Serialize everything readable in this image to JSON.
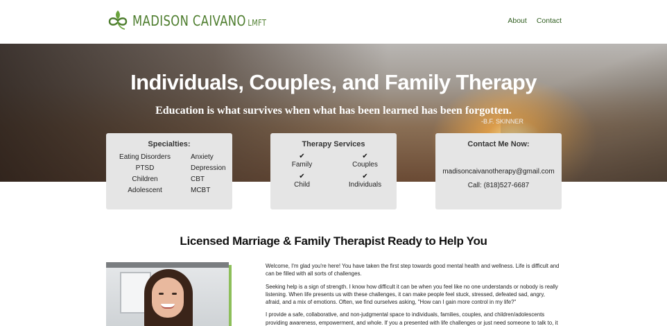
{
  "header": {
    "logo_text": "MADISON CAIVANO",
    "logo_suffix": "LMFT",
    "nav": [
      {
        "label": "About"
      },
      {
        "label": "Contact"
      }
    ]
  },
  "hero": {
    "title": "Individuals, Couples, and Family Therapy",
    "quote": "Education is what survives when what has been learned has been forgotten.",
    "quote_author": "-B.F. SKINNER"
  },
  "cards": {
    "specialties": {
      "title": "Specialties:",
      "items": [
        "Eating Disorders",
        "Anxiety",
        "PTSD",
        "Depression",
        "Children",
        "CBT",
        "Adolescent",
        "MCBT"
      ]
    },
    "services": {
      "title": "Therapy Services",
      "items": [
        "Family",
        "Couples",
        "Child",
        "Individuals"
      ]
    },
    "contact": {
      "title": "Contact Me Now:",
      "email": "madisoncaivanotherapy@gmail.com",
      "phone": "Call: (818)527-6687"
    }
  },
  "main": {
    "section_title": "Licensed Marriage & Family Therapist Ready to Help You",
    "paragraphs": [
      "Welcome, I'm glad you're here! You have taken the first step towards good mental health and wellness. Life is difficult and can be filled with all sorts of challenges.",
      "Seeking help is a sign of strength. I know how difficult it can be when you feel like no one understands or nobody is really listening. When life presents us with these challenges, it can make people feel stuck, stressed, defeated sad, angry, afraid, and a mix of emotions. Often, we find ourselves asking, \"How can I gain more control in my life?\"",
      "I provide a safe, collaborative, and non-judgmental space to individuals, families, couples, and children/adolescents providing awareness, empowerment, and whole. If you a presented with life challenges or just need someone to talk to, it"
    ]
  },
  "colors": {
    "brand_green": "#4c7c2c",
    "nav_green": "#2f5d1f",
    "accent_green": "#8dbf5a",
    "card_bg": "#e5e5e5"
  }
}
